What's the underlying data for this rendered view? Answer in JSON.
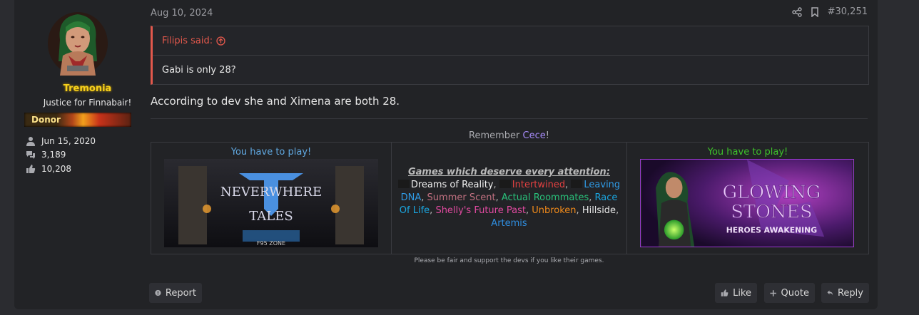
{
  "user": {
    "username": "Tremonia",
    "title": "Justice for Finnabair!",
    "banner": "Donor",
    "joined": "Jun 15, 2020",
    "messages": "3,189",
    "reactions": "10,208"
  },
  "post": {
    "date": "Aug 10, 2024",
    "number": "#30,251",
    "quote": {
      "author": "Filipis said:",
      "text": "Gabi is only 28?"
    },
    "text": "According to dev she and Ximena are both 28."
  },
  "signature": {
    "remember_prefix": "Remember ",
    "remember_name": "Cece",
    "remember_suffix": "!",
    "left_heading": "You have to play!",
    "right_heading": "You have to play!",
    "games_heading": "Games which deserve every attention:",
    "games": [
      {
        "name": "Dreams of Reality",
        "color": "#f0f0f0"
      },
      {
        "name": "Intertwined",
        "color": "#e04040"
      },
      {
        "name": "Leaving DNA",
        "color": "#2f9be6"
      },
      {
        "name": "Summer Scent",
        "color": "#c07080"
      },
      {
        "name": "Actual Roommates",
        "color": "#29c07a"
      },
      {
        "name": "Race Of Life",
        "color": "#1aa6e0"
      },
      {
        "name": "Shelly's Future Past",
        "color": "#e04aa0"
      },
      {
        "name": "Unbroken",
        "color": "#f08a1a"
      },
      {
        "name": "Hillside",
        "color": "#e8e8e8"
      },
      {
        "name": "Artemis",
        "color": "#2f8ee0"
      }
    ],
    "left_game_lines": [
      "NEVERWHERE",
      "TALES"
    ],
    "left_game_studio": "F95         ZONE",
    "right_game_lines": [
      "GLOWING",
      "STONES"
    ],
    "right_game_sub": "HEROES AWAKENING",
    "note": "Please be fair and support the devs if you like their games."
  },
  "buttons": {
    "report": "Report",
    "like": "Like",
    "quote": "Quote",
    "reply": "Reply"
  },
  "colors": {
    "accent_quote": "#e2584c",
    "username": "#f7d11c",
    "cece": "#a78bfa"
  }
}
